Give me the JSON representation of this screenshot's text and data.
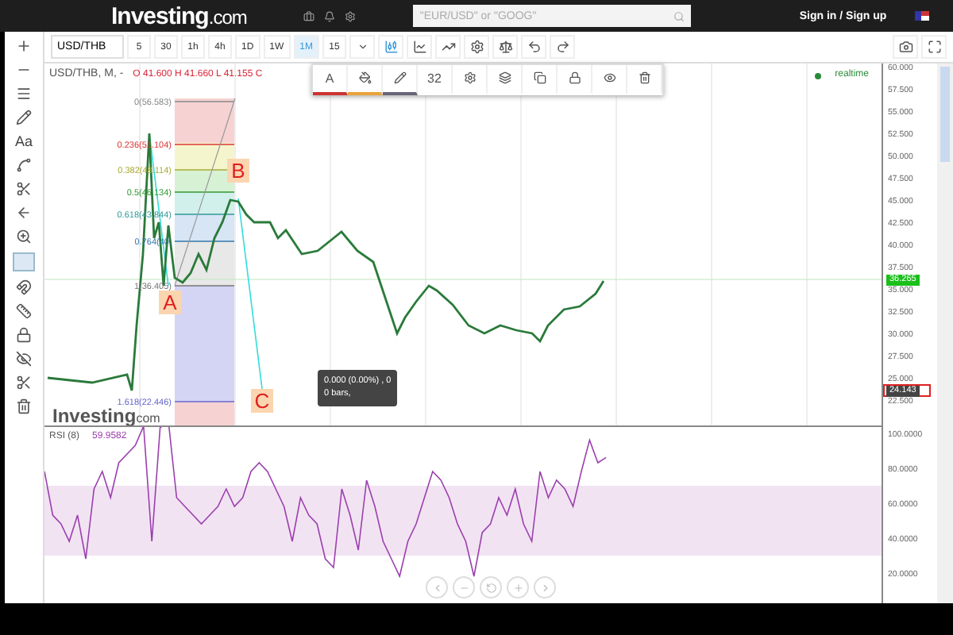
{
  "header": {
    "logo": "Investing",
    "logo_suffix": ".com",
    "search": {
      "placeholder": "\"EUR/USD\" or \"GOOG\""
    },
    "sign_in": "Sign in / Sign up"
  },
  "toolbar": {
    "symbol": "USD/THB",
    "intervals": [
      {
        "label": "5",
        "selected": false
      },
      {
        "label": "30",
        "selected": false
      },
      {
        "label": "1h",
        "selected": false
      },
      {
        "label": "4h",
        "selected": false
      },
      {
        "label": "1D",
        "selected": false
      },
      {
        "label": "1W",
        "selected": false
      },
      {
        "label": "1M",
        "selected": true
      },
      {
        "label": "15",
        "selected": false
      }
    ]
  },
  "sidebar": {
    "text_tool": "Aa"
  },
  "chart": {
    "legend": "USD/THB, M, -",
    "ohlc": "O 41.600 H 41.660 L 41.155 C",
    "realtime": "realtime",
    "watermark": "Investing",
    "watermark_suffix": "com",
    "drawing_toolbar": {
      "text_label": "A",
      "font_size": "32"
    },
    "fib_levels": [
      "0(56.583)",
      "0.236(51.104)",
      "0.382(48.114)",
      "0.5(46.134)",
      "0.618(43.844)",
      "0.764(40.",
      "1(36.405)",
      "1.618(22.446)"
    ],
    "points": [
      "A",
      "B",
      "C"
    ],
    "tooltip": [
      "0.000 (0.00%) , 0",
      "0 bars,"
    ],
    "price_axis": [
      "60.000",
      "57.500",
      "55.000",
      "52.500",
      "50.000",
      "47.500",
      "45.000",
      "42.500",
      "40.000",
      "37.500",
      "35.000",
      "32.500",
      "30.000",
      "27.500",
      "25.000",
      "22.500"
    ],
    "last_price": "36.265",
    "cursor_price": "24.143"
  },
  "rsi": {
    "label": "RSI (8)",
    "value": "59.9582",
    "axis": [
      "100.0000",
      "80.0000",
      "60.0000",
      "40.0000",
      "20.0000"
    ]
  }
}
